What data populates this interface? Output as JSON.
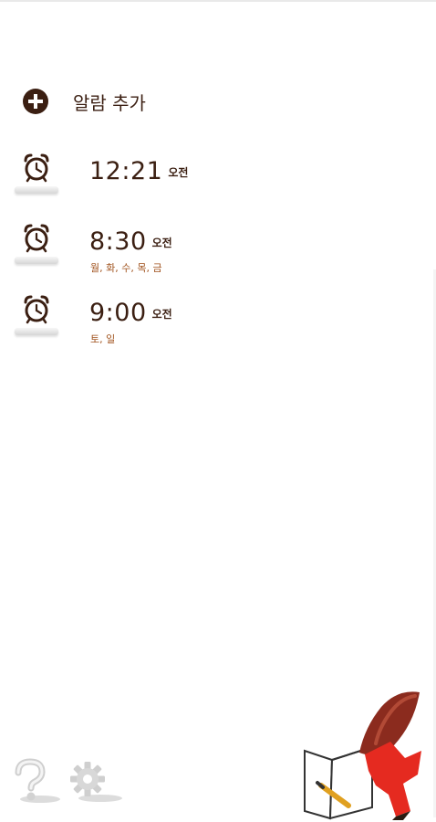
{
  "header": {
    "add_alarm_label": "알람 추가"
  },
  "alarms": [
    {
      "time": "12:21",
      "period": "오전",
      "days": ""
    },
    {
      "time": "8:30",
      "period": "오전",
      "days": "월, 화, 수, 목, 금"
    },
    {
      "time": "9:00",
      "period": "오전",
      "days": "토, 일"
    }
  ],
  "icons": {
    "add": "plus-circle-icon",
    "alarm": "alarm-clock-icon",
    "help": "question-mark-icon",
    "settings": "gear-icon",
    "mascot": "sweet-potato-character-icon"
  },
  "colors": {
    "text_dark": "#3b1f12",
    "days_text": "#a0521d",
    "icon_dark": "#3b1f12"
  }
}
